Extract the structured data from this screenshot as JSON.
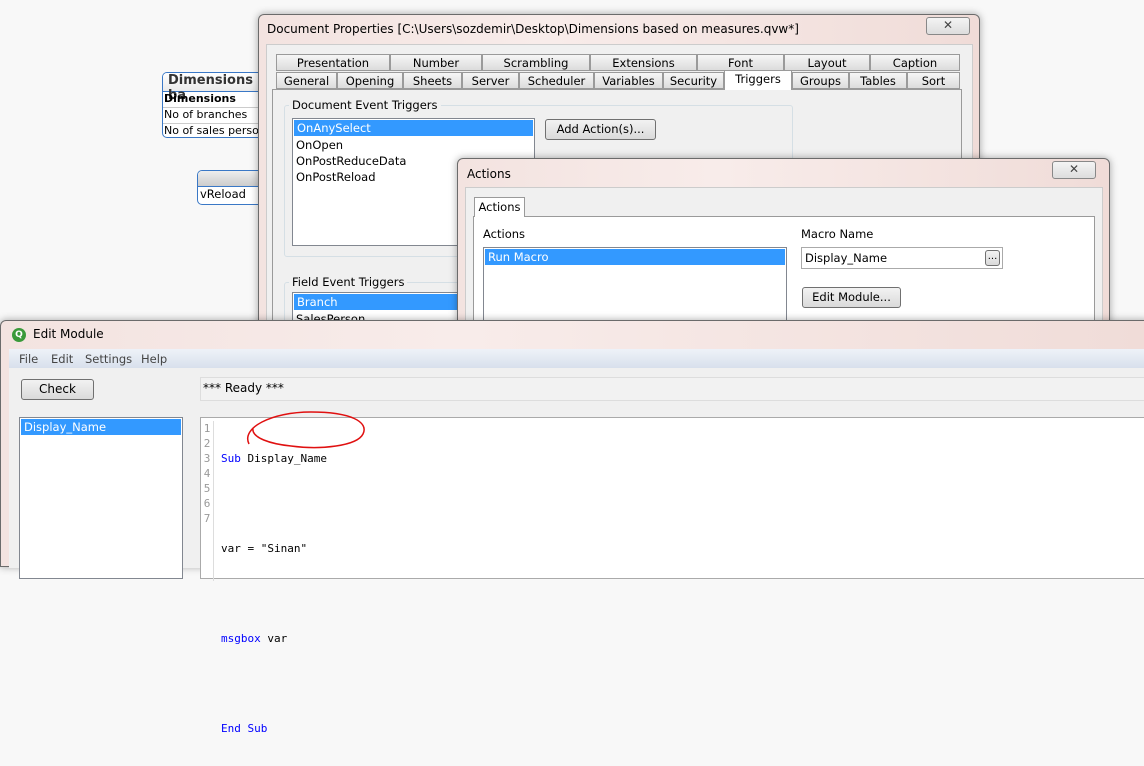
{
  "background": {
    "dimensions_box": {
      "title": "Dimensions ba",
      "header": "Dimensions",
      "rows": [
        "No of branches",
        "No of sales person"
      ]
    },
    "variable_box": {
      "row": "vReload"
    }
  },
  "doc_props": {
    "title": "Document Properties [C:\\Users\\sozdemir\\Desktop\\Dimensions based on measures.qvw*]",
    "close": "✕",
    "tabs_row1": [
      "Presentation",
      "Number",
      "Scrambling",
      "Extensions",
      "Font",
      "Layout",
      "Caption"
    ],
    "tabs_row2": [
      "General",
      "Opening",
      "Sheets",
      "Server",
      "Scheduler",
      "Variables",
      "Security",
      "Triggers",
      "Groups",
      "Tables",
      "Sort"
    ],
    "active_tab": "Triggers",
    "doc_event_label": "Document Event Triggers",
    "doc_events": [
      "OnAnySelect",
      "OnOpen",
      "OnPostReduceData",
      "OnPostReload"
    ],
    "add_action": "Add Action(s)...",
    "field_event_label": "Field Event Triggers",
    "field_events": [
      "Branch",
      "SalesPerson"
    ]
  },
  "actions_dialog": {
    "title": "Actions",
    "close": "✕",
    "tab": "Actions",
    "actions_label": "Actions",
    "actions": [
      "Run Macro"
    ],
    "macro_label": "Macro Name",
    "macro_value": "Display_Name",
    "browse": "...",
    "edit_module": "Edit Module..."
  },
  "edit_module": {
    "title": "Edit Module",
    "logo": "Q",
    "menu": [
      "File",
      "Edit",
      "Settings",
      "Help"
    ],
    "check": "Check",
    "status": "*** Ready ***",
    "modules": [
      "Display_Name"
    ],
    "lines": [
      "1",
      "2",
      "3",
      "4",
      "5",
      "6",
      "7"
    ],
    "code": {
      "l1kw": "Sub",
      "l1": "Display_Name",
      "l3": "var = \"Sinan\"",
      "l5kw": "msgbox",
      "l5": "var",
      "l7kw": "End Sub"
    }
  }
}
